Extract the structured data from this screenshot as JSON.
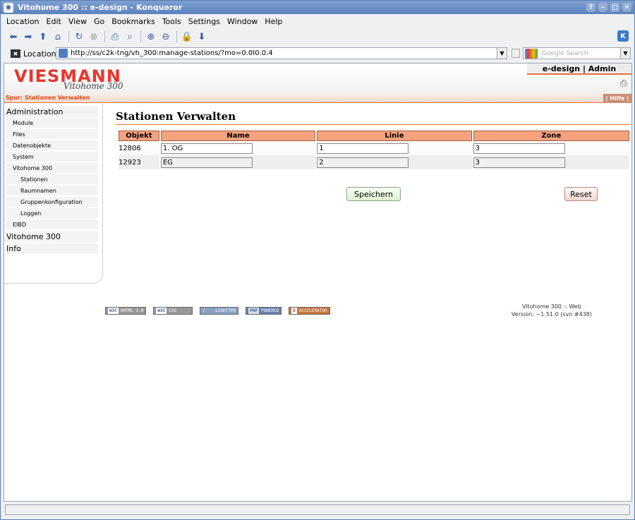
{
  "window": {
    "title": "Vitohome 300 :: e-design - Konqueror",
    "controls": [
      "?",
      "–",
      "□",
      "✕"
    ]
  },
  "menubar": {
    "items": [
      "Location",
      "Edit",
      "View",
      "Go",
      "Bookmarks",
      "Tools",
      "Settings",
      "Window",
      "Help"
    ]
  },
  "toolbar": {
    "icons": [
      "back-icon",
      "forward-icon",
      "up-icon",
      "home-icon",
      "reload-icon",
      "stop-icon",
      "print-icon",
      "find-icon",
      "zoom-in-icon",
      "zoom-out-icon",
      "security-icon",
      "download-icon"
    ]
  },
  "location": {
    "label": "Location:",
    "url": "http://ss/c2k-tng/vh_300:manage-stations/?mo=0.0I0.0.4",
    "search_placeholder": "Google Search"
  },
  "site": {
    "logo": "VIESMANN",
    "logo_sub": "Vitohome 300",
    "user": "e-design | Admin",
    "breadcrumb": "Spur: Stationen Verwalten",
    "help": "| Hilfe |"
  },
  "sidebar": {
    "items": [
      {
        "label": "Administration",
        "level": 0
      },
      {
        "label": "Module",
        "level": 1
      },
      {
        "label": "Files",
        "level": 1
      },
      {
        "label": "Datenobjekte",
        "level": 1
      },
      {
        "label": "System",
        "level": 1
      },
      {
        "label": "Vitohome 300",
        "level": 1
      },
      {
        "label": "Stationen",
        "level": 2
      },
      {
        "label": "Raumnamen",
        "level": 2
      },
      {
        "label": "Gruppenkonfiguration",
        "level": 2
      },
      {
        "label": "Loggen",
        "level": 2
      },
      {
        "label": "EIBD",
        "level": 1
      },
      {
        "label": "Vitohome 300",
        "level": 0
      },
      {
        "label": "Info",
        "level": 0
      }
    ]
  },
  "main": {
    "title": "Stationen Verwalten",
    "columns": [
      "Objekt",
      "Name",
      "Linie",
      "Zone"
    ],
    "rows": [
      {
        "objekt": "12806",
        "name": "1. OG",
        "linie": "1",
        "zone": "3"
      },
      {
        "objekt": "12923",
        "name": "EG",
        "linie": "2",
        "zone": "3"
      }
    ],
    "save_label": "Speichern",
    "reset_label": "Reset"
  },
  "footer": {
    "badges": [
      {
        "lead": "W3C",
        "text": "XHTML 1.0"
      },
      {
        "lead": "W3C",
        "text": "CSS"
      },
      {
        "lead": "",
        "text": "LIGHTTPD"
      },
      {
        "lead": "PHP",
        "text": "POWERED"
      },
      {
        "lead": "E",
        "text": "ACCELERATOR"
      }
    ],
    "version_line1": "Vitohome 300 :: Web",
    "version_line2": "Version: ~1.51.0 (svn #438)"
  },
  "colors": {
    "accent": "#e8703a",
    "header_cell": "#f5a27e",
    "logo_red": "#e8372a",
    "titlebar": "#5c82bf"
  }
}
